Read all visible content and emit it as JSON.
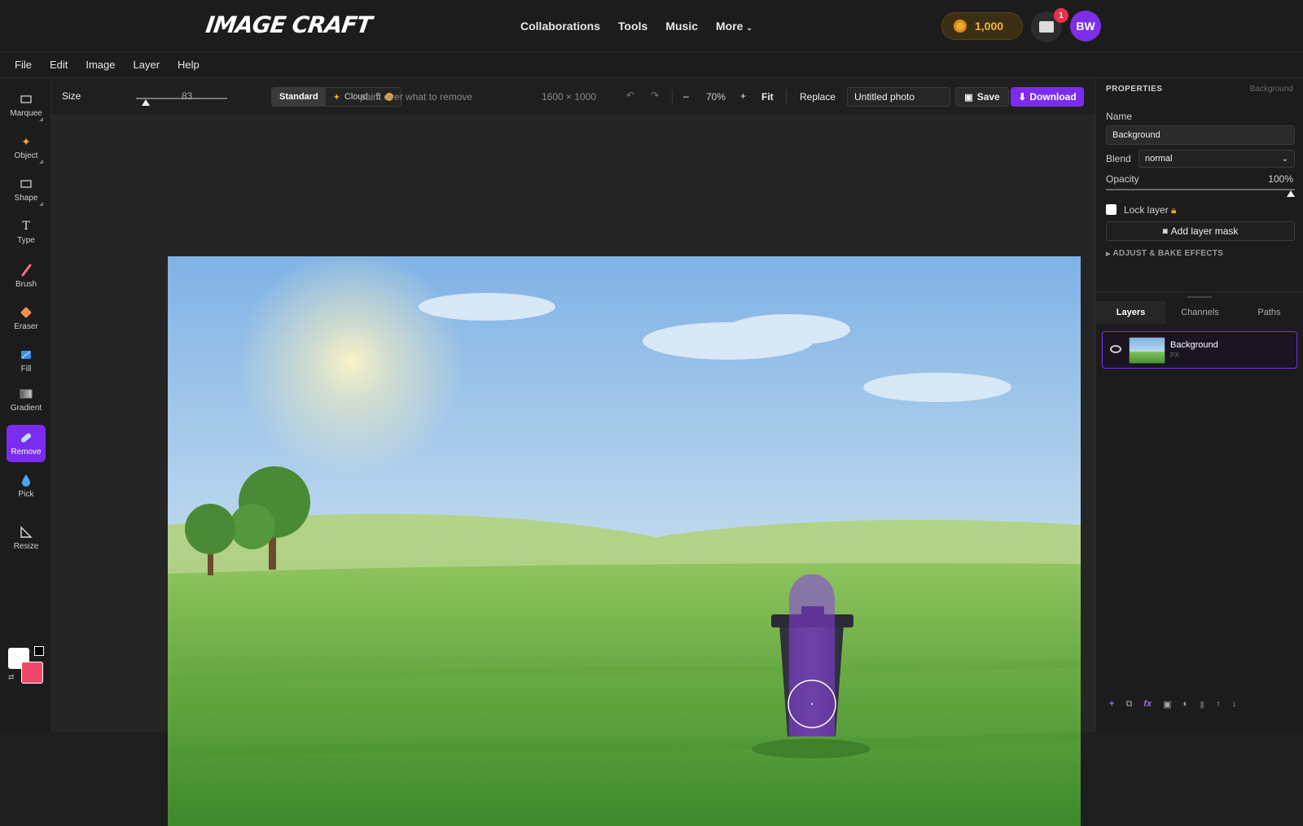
{
  "app": {
    "logo": "IMAGE CRAFT",
    "nav": [
      "Collaborations",
      "Tools",
      "Music",
      "More"
    ],
    "coins": "1,000",
    "notifications": "1",
    "avatar": "BW"
  },
  "menu": [
    "File",
    "Edit",
    "Image",
    "Layer",
    "Help"
  ],
  "tools": [
    {
      "label": "Marquee",
      "icon": "marquee-icon"
    },
    {
      "label": "Object",
      "icon": "sparkle-icon"
    },
    {
      "label": "Shape",
      "icon": "rectangle-icon"
    },
    {
      "label": "Type",
      "icon": "type-icon"
    },
    {
      "label": "Brush",
      "icon": "brush-icon"
    },
    {
      "label": "Eraser",
      "icon": "eraser-icon"
    },
    {
      "label": "Fill",
      "icon": "bucket-icon"
    },
    {
      "label": "Gradient",
      "icon": "gradient-icon"
    },
    {
      "label": "Remove",
      "icon": "bandage-icon"
    },
    {
      "label": "Pick",
      "icon": "droplet-icon"
    },
    {
      "label": "Resize",
      "icon": "ruler-icon"
    }
  ],
  "colors": {
    "foreground": "#ffffff",
    "background": "#f04a6a",
    "accent": "#7b2cf0",
    "coin": "#f0a830"
  },
  "options": {
    "size_label": "Size",
    "size_value": "83",
    "size_fraction": 0.11,
    "mode_standard": "Standard",
    "mode_cloud": "Cloud · 5",
    "hint": "paint over what to remove",
    "dimensions": "1600 × 1000",
    "undo": "↶",
    "redo": "↷",
    "zoom_out": "–",
    "zoom": "70%",
    "zoom_in": "+",
    "fit": "Fit",
    "replace": "Replace",
    "title_value": "Untitled photo",
    "save": "Save",
    "download": "Download"
  },
  "properties": {
    "header": "PROPERTIES",
    "header_sub": "Background",
    "name_label": "Name",
    "name_value": "Background",
    "blend_label": "Blend",
    "blend_value": "normal",
    "opacity_label": "Opacity",
    "opacity_value": "100%",
    "opacity_fraction": 1.0,
    "lock_label": "Lock layer",
    "add_mask": "Add layer mask",
    "adjust": "ADJUST & BAKE EFFECTS"
  },
  "layers_panel": {
    "tabs": [
      "Layers",
      "Channels",
      "Paths"
    ],
    "layer_name": "Background",
    "layer_type": "PX"
  }
}
